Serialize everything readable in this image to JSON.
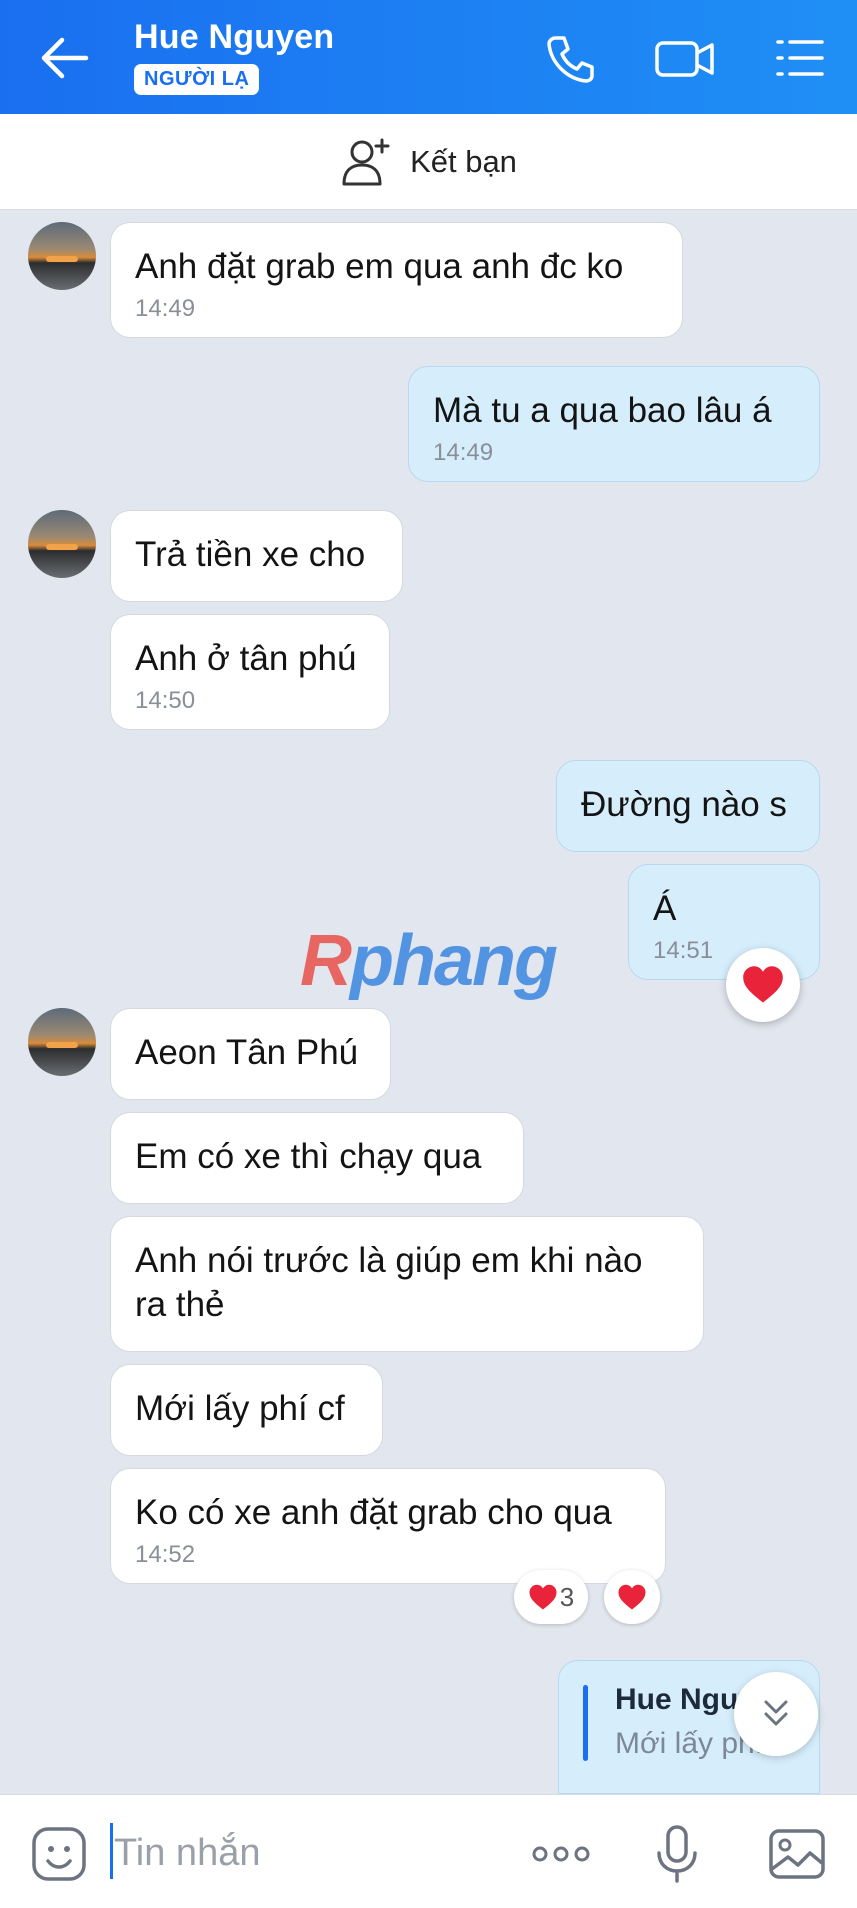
{
  "header": {
    "title": "Hue Nguyen",
    "badge": "NGƯỜI LẠ"
  },
  "friend_bar": {
    "label": "Kết bạn"
  },
  "watermark": {
    "part1": "R",
    "part2": "phang"
  },
  "messages": [
    {
      "text": "Anh đặt grab em qua anh đc ko",
      "time": "14:49"
    },
    {
      "text": "Mà tu a qua bao lâu á",
      "time": "14:49"
    },
    {
      "text": "Trả tiền xe cho"
    },
    {
      "text": "Anh ở tân phú",
      "time": "14:50"
    },
    {
      "text": "Đường nào s"
    },
    {
      "text": "Á",
      "time": "14:51"
    },
    {
      "text": "Aeon Tân Phú"
    },
    {
      "text": "Em có xe thì chạy qua"
    },
    {
      "text": "Anh nói trước là giúp em khi nào ra thẻ"
    },
    {
      "text": "Mới lấy phí cf"
    },
    {
      "text": "Ko có xe anh đặt grab cho qua",
      "time": "14:52"
    }
  ],
  "reaction_count": "3",
  "quote": {
    "name": "Hue Nguyen",
    "text": "Mới lấy phí cf"
  },
  "input": {
    "placeholder": "Tin nhắn"
  },
  "colors": {
    "header_blue": "#1a6ff0",
    "out_bubble": "#d6eefc",
    "heart": "#e8233a"
  }
}
